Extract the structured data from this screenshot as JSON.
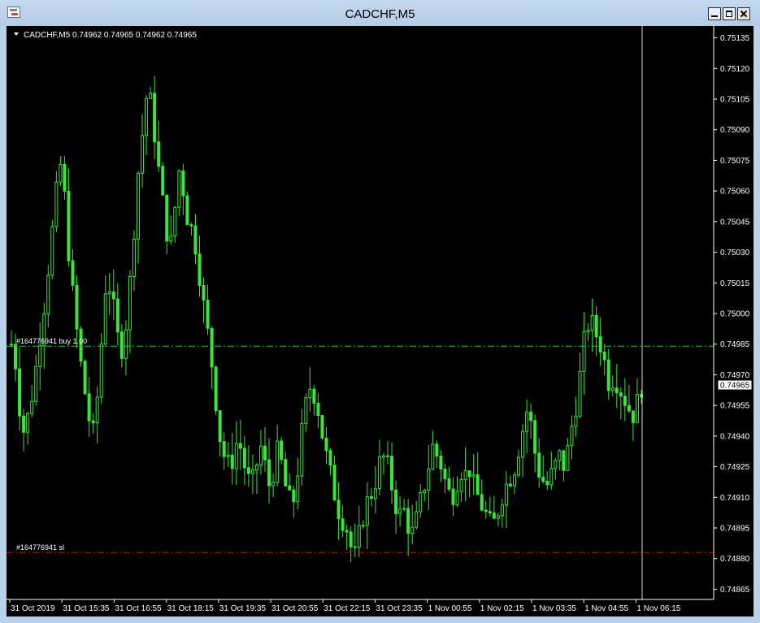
{
  "window": {
    "title": "CADCHF,M5",
    "buttons": {
      "minimize": "minimize",
      "maximize": "maximize",
      "close": "close"
    }
  },
  "chart_data": {
    "type": "candlestick",
    "symbol_info": "CADCHF,M5  0.74962 0.74965 0.74962 0.74965",
    "ylim": [
      0.7486,
      0.7514
    ],
    "ytick_labels": [
      "0.75135",
      "0.75120",
      "0.75105",
      "0.75090",
      "0.75075",
      "0.75060",
      "0.75045",
      "0.75030",
      "0.75015",
      "0.75000",
      "0.74985",
      "0.74970",
      "0.74955",
      "0.74940",
      "0.74925",
      "0.74910",
      "0.74895",
      "0.74880",
      "0.74865"
    ],
    "ytick_values": [
      0.75135,
      0.7512,
      0.75105,
      0.7509,
      0.75075,
      0.7506,
      0.75045,
      0.7503,
      0.75015,
      0.75,
      0.74985,
      0.7497,
      0.74955,
      0.7494,
      0.74925,
      0.7491,
      0.74895,
      0.7488,
      0.74865
    ],
    "xtick_labels": [
      "31 Oct 2019",
      "31 Oct 15:35",
      "31 Oct 16:55",
      "31 Oct 18:15",
      "31 Oct 19:35",
      "31 Oct 20:55",
      "31 Oct 22:15",
      "31 Oct 23:35",
      "1 Nov 00:55",
      "1 Nov 02:15",
      "1 Nov 03:35",
      "1 Nov 04:55",
      "1 Nov 06:15"
    ],
    "current_price": "0.74965",
    "current_price_value": 0.74965,
    "order_lines": [
      {
        "label": "#164776941 buy 1.00",
        "price": 0.74984,
        "color": "#22c33a",
        "style": "dash-dot"
      },
      {
        "label": "#164776941 sl",
        "price": 0.74883,
        "color": "#c0141e",
        "style": "dash-dot"
      }
    ],
    "close_path": [
      [
        0.74985,
        0.74975,
        0.7495,
        0.7494,
        0.74955,
        0.74965,
        0.74985,
        0.75,
        0.7502,
        0.7504,
        0.7506,
        0.75075,
        0.7505,
        0.7502,
        0.75,
        0.7498,
        0.74965,
        0.7495,
        0.7494,
        0.7496,
        0.7499,
        0.7502,
        0.7501,
        0.74995,
        0.7498,
        0.7499,
        0.7501,
        0.7504,
        0.7507,
        0.7509,
        0.7511,
        0.751,
        0.7508,
        0.7506,
        0.75045,
        0.7503,
        0.7505,
        0.7507,
        0.7506,
        0.75045,
        0.7504,
        0.7503,
        0.7501,
        0.74995,
        0.7498,
        0.7496,
        0.7494,
        0.7493,
        0.74925,
        0.7493,
        0.7494,
        0.7493,
        0.7492,
        0.74915,
        0.74925,
        0.74935,
        0.74925,
        0.74915,
        0.74925,
        0.74935,
        0.7492,
        0.7491,
        0.74905,
        0.7492,
        0.7494,
        0.74955,
        0.74965,
        0.7496,
        0.7495,
        0.74935,
        0.74925,
        0.74915,
        0.74905,
        0.749,
        0.74895,
        0.74885,
        0.7488,
        0.74895,
        0.74905,
        0.7491,
        0.74915,
        0.74925,
        0.7493,
        0.74925,
        0.74915,
        0.74905,
        0.749,
        0.74905,
        0.7489,
        0.74895,
        0.74905,
        0.74915,
        0.74925,
        0.74935,
        0.7493,
        0.74925,
        0.74915,
        0.7491,
        0.74915,
        0.74925,
        0.7492,
        0.74925,
        0.74915,
        0.7491,
        0.74905,
        0.749,
        0.74895,
        0.749,
        0.7491,
        0.74915,
        0.7492,
        0.74925,
        0.74935,
        0.74945,
        0.74955,
        0.7494,
        0.74925,
        0.7492,
        0.74915,
        0.7492,
        0.74925,
        0.7493,
        0.74925,
        0.74935,
        0.7495,
        0.7496,
        0.7498,
        0.74995,
        0.74995,
        0.7499,
        0.74985,
        0.74975,
        0.74965,
        0.7497,
        0.74965,
        0.7496,
        0.74955,
        0.7495,
        0.74955,
        0.74965
      ]
    ]
  }
}
